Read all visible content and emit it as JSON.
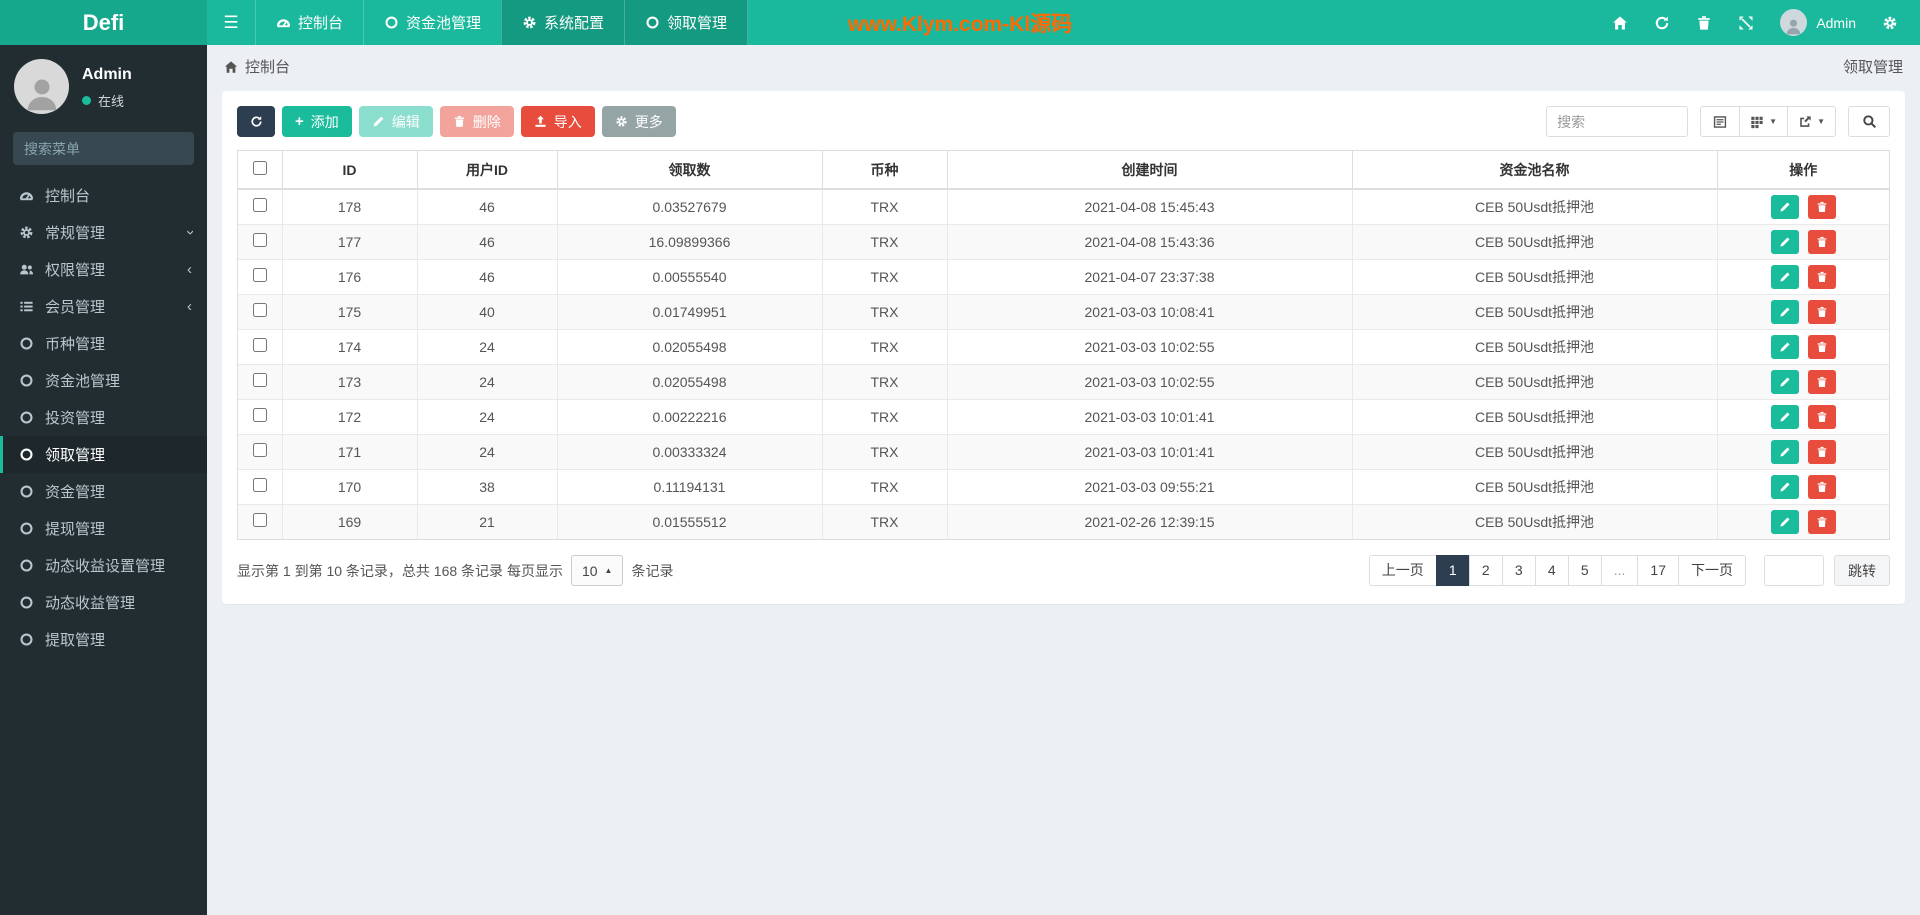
{
  "topbar": {
    "brand": "Defi",
    "nav": [
      {
        "label": "控制台",
        "icon": "dashboard",
        "active": false
      },
      {
        "label": "资金池管理",
        "icon": "circle",
        "active": false
      },
      {
        "label": "系统配置",
        "icon": "gears",
        "active": true
      },
      {
        "label": "领取管理",
        "icon": "circle",
        "active": true
      }
    ],
    "watermark": "www.Klym.com-Kl源码",
    "user_name": "Admin"
  },
  "sidebar": {
    "user": {
      "name": "Admin",
      "status": "在线"
    },
    "search_placeholder": "搜索菜单",
    "menu": [
      {
        "label": "控制台",
        "icon": "dashboard"
      },
      {
        "label": "常规管理",
        "icon": "gears",
        "chevron": "down"
      },
      {
        "label": "权限管理",
        "icon": "users",
        "chevron": "left"
      },
      {
        "label": "会员管理",
        "icon": "list",
        "chevron": "left"
      },
      {
        "label": "币种管理",
        "icon": "circle"
      },
      {
        "label": "资金池管理",
        "icon": "circle"
      },
      {
        "label": "投资管理",
        "icon": "circle"
      },
      {
        "label": "领取管理",
        "icon": "circle",
        "active": true
      },
      {
        "label": "资金管理",
        "icon": "circle"
      },
      {
        "label": "提现管理",
        "icon": "circle"
      },
      {
        "label": "动态收益设置管理",
        "icon": "circle"
      },
      {
        "label": "动态收益管理",
        "icon": "circle"
      },
      {
        "label": "提取管理",
        "icon": "circle"
      }
    ]
  },
  "breadcrumb": {
    "left": "控制台",
    "right": "领取管理"
  },
  "toolbar": {
    "add_label": "添加",
    "edit_label": "编辑",
    "delete_label": "删除",
    "import_label": "导入",
    "more_label": "更多",
    "search_placeholder": "搜索"
  },
  "table": {
    "columns": [
      "ID",
      "用户ID",
      "领取数",
      "币种",
      "创建时间",
      "资金池名称",
      "操作"
    ],
    "rows": [
      {
        "id": "178",
        "uid": "46",
        "amount": "0.03527679",
        "coin": "TRX",
        "created": "2021-04-08 15:45:43",
        "pool": "CEB 50Usdt抵押池"
      },
      {
        "id": "177",
        "uid": "46",
        "amount": "16.09899366",
        "coin": "TRX",
        "created": "2021-04-08 15:43:36",
        "pool": "CEB 50Usdt抵押池"
      },
      {
        "id": "176",
        "uid": "46",
        "amount": "0.00555540",
        "coin": "TRX",
        "created": "2021-04-07 23:37:38",
        "pool": "CEB 50Usdt抵押池"
      },
      {
        "id": "175",
        "uid": "40",
        "amount": "0.01749951",
        "coin": "TRX",
        "created": "2021-03-03 10:08:41",
        "pool": "CEB 50Usdt抵押池"
      },
      {
        "id": "174",
        "uid": "24",
        "amount": "0.02055498",
        "coin": "TRX",
        "created": "2021-03-03 10:02:55",
        "pool": "CEB 50Usdt抵押池"
      },
      {
        "id": "173",
        "uid": "24",
        "amount": "0.02055498",
        "coin": "TRX",
        "created": "2021-03-03 10:02:55",
        "pool": "CEB 50Usdt抵押池"
      },
      {
        "id": "172",
        "uid": "24",
        "amount": "0.00222216",
        "coin": "TRX",
        "created": "2021-03-03 10:01:41",
        "pool": "CEB 50Usdt抵押池"
      },
      {
        "id": "171",
        "uid": "24",
        "amount": "0.00333324",
        "coin": "TRX",
        "created": "2021-03-03 10:01:41",
        "pool": "CEB 50Usdt抵押池"
      },
      {
        "id": "170",
        "uid": "38",
        "amount": "0.11194131",
        "coin": "TRX",
        "created": "2021-03-03 09:55:21",
        "pool": "CEB 50Usdt抵押池"
      },
      {
        "id": "169",
        "uid": "21",
        "amount": "0.01555512",
        "coin": "TRX",
        "created": "2021-02-26 12:39:15",
        "pool": "CEB 50Usdt抵押池"
      }
    ]
  },
  "footer": {
    "summary_prefix": "显示第 1 到第 10 条记录，总共 168 条记录 每页显示",
    "page_size": "10",
    "summary_suffix": "条记录",
    "pagination": {
      "prev": "上一页",
      "pages": [
        {
          "label": "1",
          "active": true
        },
        {
          "label": "2"
        },
        {
          "label": "3"
        },
        {
          "label": "4"
        },
        {
          "label": "5"
        },
        {
          "label": "...",
          "disabled": true
        },
        {
          "label": "17"
        }
      ],
      "next": "下一页",
      "jump_value": "",
      "jump_label": "跳转"
    }
  },
  "colors": {
    "navbar_teal": "#1ab99d",
    "logo_teal": "#16a88c",
    "sidebar_dark": "#222d32",
    "accent_green": "#1abc9c",
    "accent_red": "#e74c3c",
    "accent_navy": "#2c3e50",
    "accent_grey": "#95a5a6",
    "watermark_orange": "#ff6a00",
    "content_bg": "#ecf0f5"
  }
}
